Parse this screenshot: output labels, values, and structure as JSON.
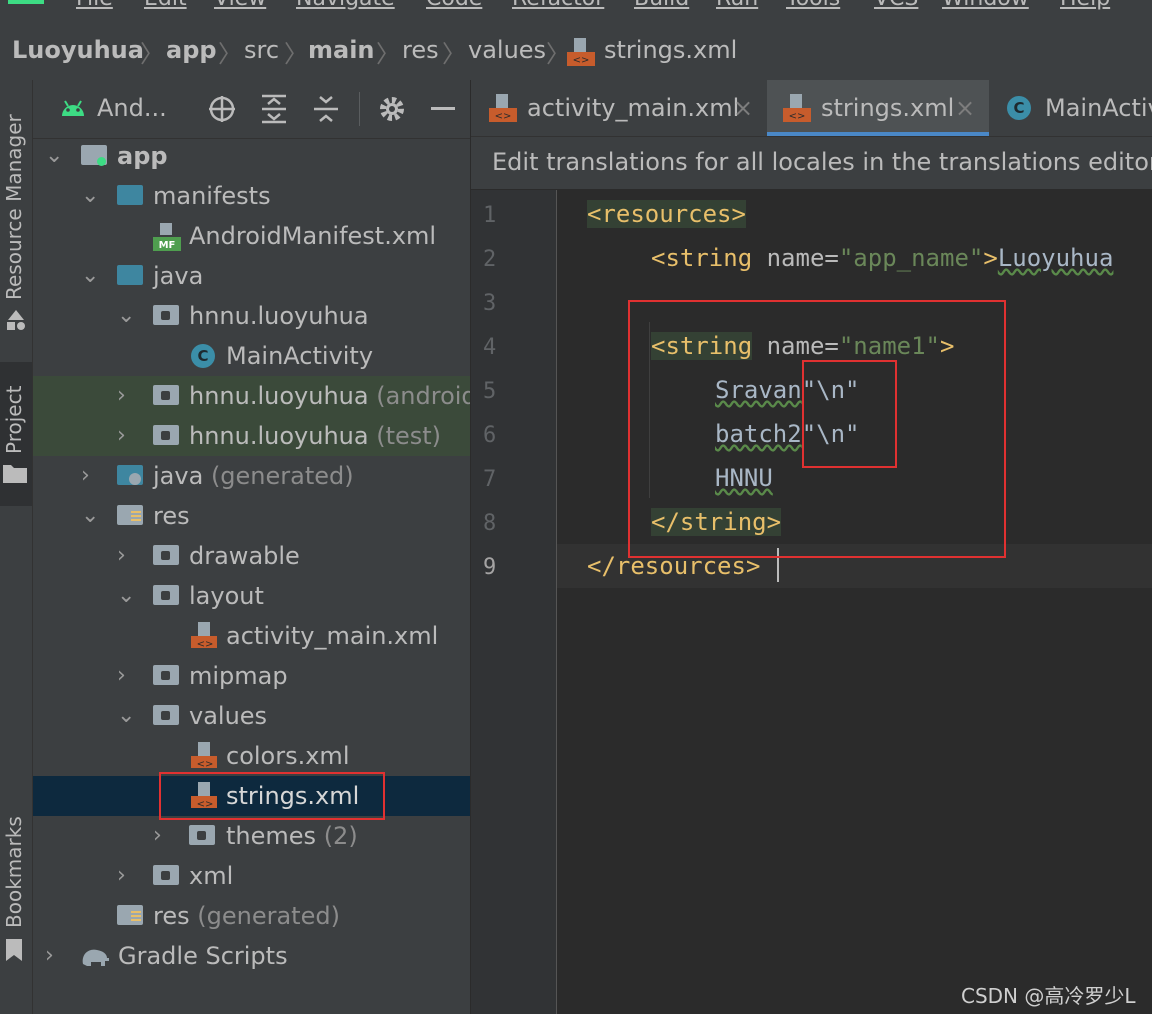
{
  "menu": [
    "File",
    "Edit",
    "View",
    "Navigate",
    "Code",
    "Refactor",
    "Build",
    "Run",
    "Tools",
    "VCS",
    "Window",
    "Help"
  ],
  "breadcrumb": [
    "Luoyuhua",
    "app",
    "src",
    "main",
    "res",
    "values",
    "strings.xml"
  ],
  "side_stripe": {
    "resource_manager": "Resource Manager",
    "project": "Project",
    "bookmarks": "Bookmarks"
  },
  "panel": {
    "title": "And..."
  },
  "tree": [
    {
      "label": "app",
      "suffix": ""
    },
    {
      "label": "manifests",
      "suffix": ""
    },
    {
      "label": "AndroidManifest.xml",
      "suffix": ""
    },
    {
      "label": "java",
      "suffix": ""
    },
    {
      "label": "hnnu.luoyuhua",
      "suffix": ""
    },
    {
      "label": "MainActivity",
      "suffix": ""
    },
    {
      "label": "hnnu.luoyuhua",
      "suffix": "(androidTest)"
    },
    {
      "label": "hnnu.luoyuhua",
      "suffix": "(test)"
    },
    {
      "label": "java",
      "suffix": "(generated)"
    },
    {
      "label": "res",
      "suffix": ""
    },
    {
      "label": "drawable",
      "suffix": ""
    },
    {
      "label": "layout",
      "suffix": ""
    },
    {
      "label": "activity_main.xml",
      "suffix": ""
    },
    {
      "label": "mipmap",
      "suffix": ""
    },
    {
      "label": "values",
      "suffix": ""
    },
    {
      "label": "colors.xml",
      "suffix": ""
    },
    {
      "label": "strings.xml",
      "suffix": ""
    },
    {
      "label": "themes",
      "suffix": "(2)"
    },
    {
      "label": "xml",
      "suffix": ""
    },
    {
      "label": "res",
      "suffix": "(generated)"
    },
    {
      "label": "Gradle Scripts",
      "suffix": ""
    }
  ],
  "tabs": [
    "activity_main.xml",
    "strings.xml",
    "MainActivity"
  ],
  "banner": "Edit translations for all locales in the translations editor.",
  "line_numbers": [
    "1",
    "2",
    "3",
    "4",
    "5",
    "6",
    "7",
    "8",
    "9"
  ],
  "code": {
    "l1_tag": "<resources>",
    "l2_open": "<string",
    "l2_attr": " name=",
    "l2_val": "\"app_name\"",
    "l2_close": ">",
    "l2_text": "Luoyuhua",
    "l4_open": "<string",
    "l4_attr": " name=",
    "l4_val": "\"name1\"",
    "l4_close": ">",
    "l5_word": "Sravan",
    "l5_esc": "\"\\n\"",
    "l6_word": "batch2",
    "l6_esc": "\"\\n\"",
    "l7_word": "HNNU",
    "l8_tag": "</string>",
    "l9_tag": "</resources>"
  },
  "watermark": "CSDN @高冷罗少L",
  "colors": {
    "accent_green": "#3ddc84",
    "highlight_red": "#e03131",
    "selection": "#0d293e",
    "tag": "#e8bf6a",
    "value": "#6a8759"
  }
}
